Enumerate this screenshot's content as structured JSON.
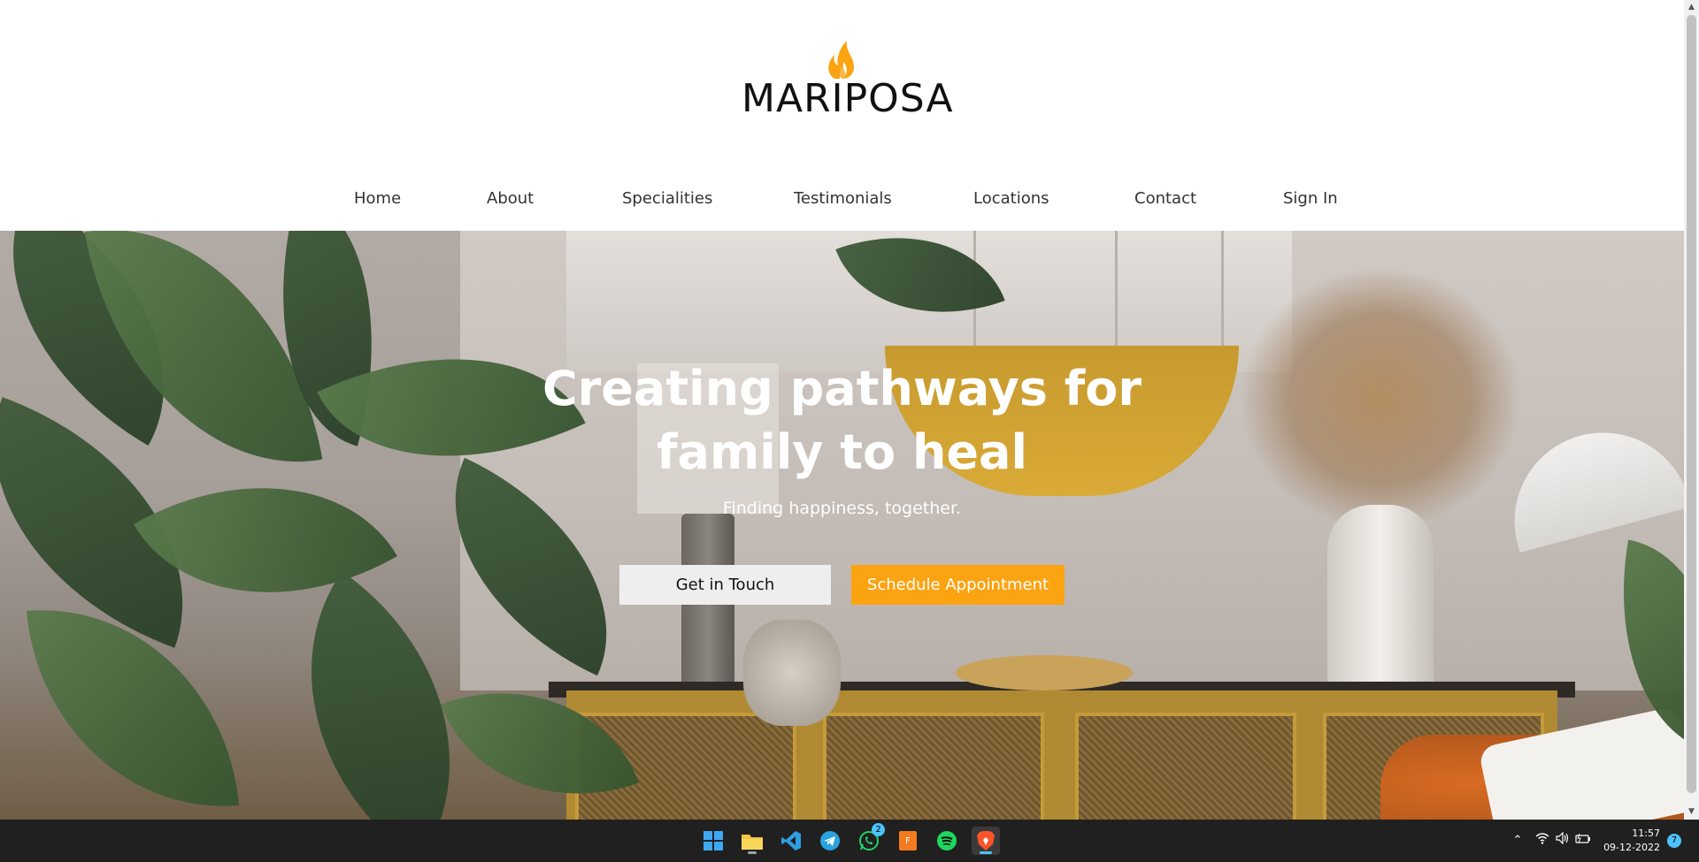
{
  "brand": {
    "name": "MARIPOSA",
    "accent_color": "#fca311",
    "logo_icon": "flame-icon"
  },
  "nav": {
    "items": [
      {
        "label": "Home"
      },
      {
        "label": "About"
      },
      {
        "label": "Specialities"
      },
      {
        "label": "Testimonials"
      },
      {
        "label": "Locations"
      },
      {
        "label": "Contact"
      },
      {
        "label": "Sign In"
      }
    ]
  },
  "hero": {
    "title_line1": "Creating pathways for",
    "title_line2": "family to heal",
    "subtitle": "Finding happiness, together.",
    "primary_button": "Get in Touch",
    "secondary_button": "Schedule Appointment"
  },
  "taskbar": {
    "apps": [
      {
        "name": "windows-start-icon"
      },
      {
        "name": "file-explorer-icon"
      },
      {
        "name": "vscode-icon"
      },
      {
        "name": "telegram-icon"
      },
      {
        "name": "whatsapp-icon",
        "badge": "2"
      },
      {
        "name": "sublime-icon"
      },
      {
        "name": "spotify-icon"
      },
      {
        "name": "brave-icon"
      }
    ],
    "clock_time": "11:57",
    "clock_date": "09-12-2022",
    "notification_count": "7"
  }
}
